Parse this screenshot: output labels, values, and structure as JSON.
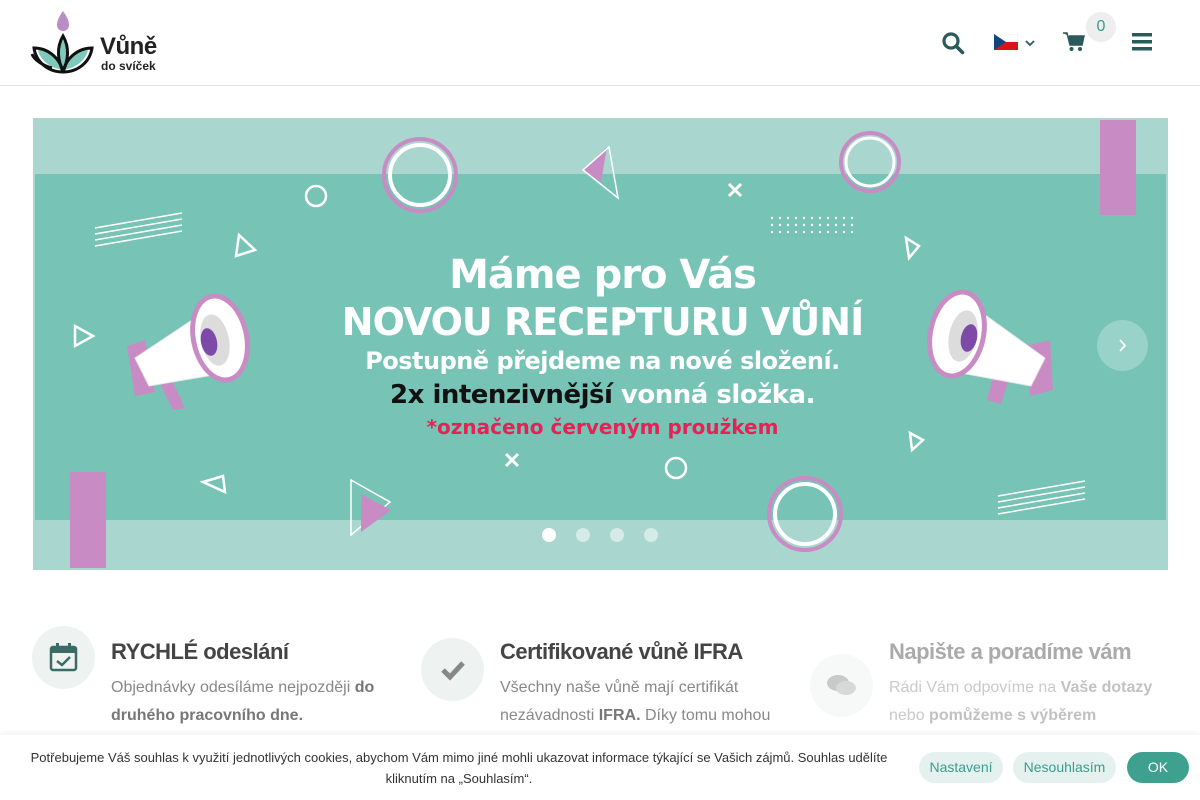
{
  "header": {
    "logo_title": "Vůně",
    "logo_subtitle": "do svíček",
    "cart_count": "0",
    "flag": "cz-flag"
  },
  "slider": {
    "line1": "Máme pro Vás",
    "line2": "NOVOU RECEPTURU VŮNÍ",
    "line3": "Postupně přejdeme na nové složení.",
    "line4_dark": "2x intenzivnější",
    "line4_light": " vonná složka.",
    "line5": "*označeno červeným proužkem",
    "slide_count": 4,
    "active_slide": 1,
    "colors": {
      "bg": "#77c3b6",
      "band": "#a9d6cf",
      "accent": "#c98bc3",
      "highlight": "#e52256"
    }
  },
  "features": [
    {
      "title": "RYCHLÉ odeslání",
      "text_pre": " Objednávky odesíláme nejpozději ",
      "text_bold": "do druhého pracovního dne.",
      "text_post": "",
      "text_bold2": "",
      "text_post2": "",
      "icon": "calendar-check-icon"
    },
    {
      "title": "Certifikované vůně IFRA",
      "text_pre": "Všechny naše vůně mají certifikát nezávadnosti ",
      "text_bold": "IFRA.",
      "text_post": " Díky tomu mohou",
      "text_bold2": "",
      "text_post2": "",
      "icon": "check-icon"
    },
    {
      "title": "Napište a poradíme vám",
      "text_pre": "Rádi Vám odpovíme na ",
      "text_bold": "Vaše dotazy",
      "text_post": " nebo ",
      "text_bold2": "pomůžeme s výběrem",
      "text_post2": "",
      "icon": "comments-icon"
    }
  ],
  "cookie": {
    "text": "Potřebujeme Váš souhlas k využití jednotlivých cookies, abychom Vám mimo jiné mohli ukazovat informace týkající se Vašich zájmů. Souhlas udělíte kliknutím na „Souhlasím“.",
    "settings_label": "Nastavení",
    "decline_label": "Nesouhlasím",
    "ok_label": "OK"
  },
  "colors": {
    "brand": "#3a9c8c",
    "header_icon": "#2a5a5a"
  }
}
